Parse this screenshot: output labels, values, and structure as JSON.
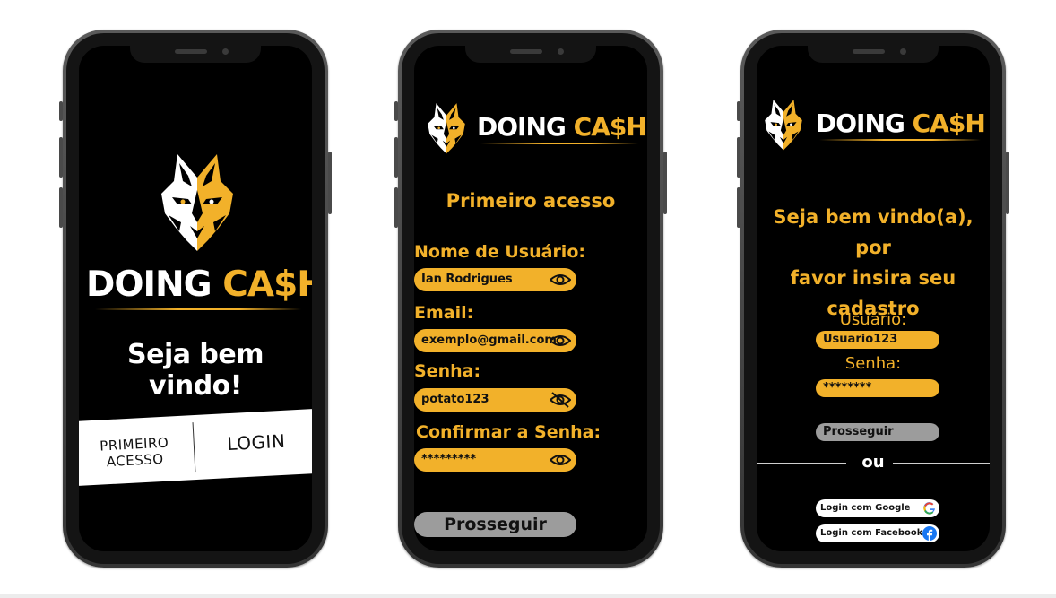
{
  "brand": {
    "word1": "DOING",
    "word2": "CA$H",
    "accent_color": "#f2b12a"
  },
  "screen1": {
    "welcome": "Seja bem vindo!",
    "primeiro_acesso_line1": "PRIMEIRO",
    "primeiro_acesso_line2": "ACESSO",
    "login": "LOGIN"
  },
  "screen2": {
    "title": "Primeiro acesso",
    "fields": [
      {
        "label": "Nome de Usuário:",
        "value": "Ian Rodrigues",
        "icon": "eye-icon"
      },
      {
        "label": "Email:",
        "value": "exemplo@gmail.com",
        "icon": "eye-icon"
      },
      {
        "label": "Senha:",
        "value": "potato123",
        "icon": "eye-off-icon"
      },
      {
        "label": "Confirmar a Senha:",
        "value": "*********",
        "icon": "eye-icon"
      }
    ],
    "submit": "Prosseguir"
  },
  "screen3": {
    "heading_line1": "Seja bem vindo(a), por",
    "heading_line2": "favor insira seu",
    "heading_line3": "cadastro",
    "user_label": "Usuário:",
    "user_value": "Usuario123",
    "password_label": "Senha:",
    "password_value": "********",
    "submit": "Prosseguir",
    "divider_text": "ou",
    "google": "Login com Google",
    "facebook": "Login com Facebook"
  }
}
